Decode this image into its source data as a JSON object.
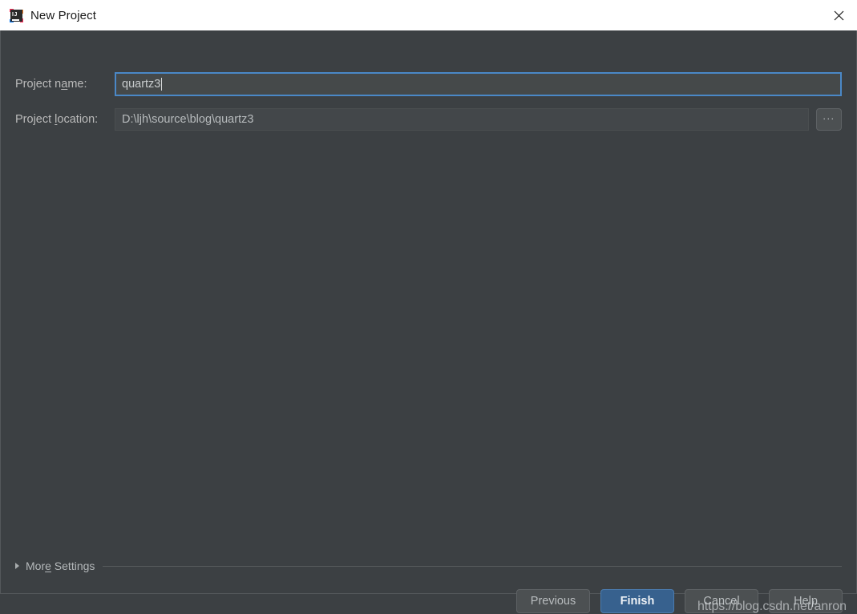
{
  "window": {
    "title": "New Project",
    "app_icon": "intellij-idea-icon",
    "icon_text": "IJ",
    "close_label": "✕"
  },
  "form": {
    "name_row": {
      "label_pre": "Project n",
      "label_mnemonic": "a",
      "label_post": "me:",
      "value": "quartz3",
      "placeholder": ""
    },
    "location_row": {
      "label_pre": "Project ",
      "label_mnemonic": "l",
      "label_post": "ocation:",
      "value": "D:\\ljh\\source\\blog\\quartz3",
      "placeholder": "",
      "browse_label": "..."
    }
  },
  "more_settings": {
    "label_pre": "Mor",
    "label_mnemonic": "e",
    "label_post": " Settings",
    "expanded": false
  },
  "buttons": {
    "previous": "Previous",
    "finish": "Finish",
    "cancel": "Cancel",
    "help": "Help"
  },
  "watermark": {
    "text": "https://blog.csdn.net/anron"
  },
  "colors": {
    "dialog_background": "#3c4043",
    "titlebar_background": "#ffffff",
    "accent_focus": "#4a88c7",
    "primary_button": "#37618e",
    "label_text": "#bbbbbb"
  }
}
